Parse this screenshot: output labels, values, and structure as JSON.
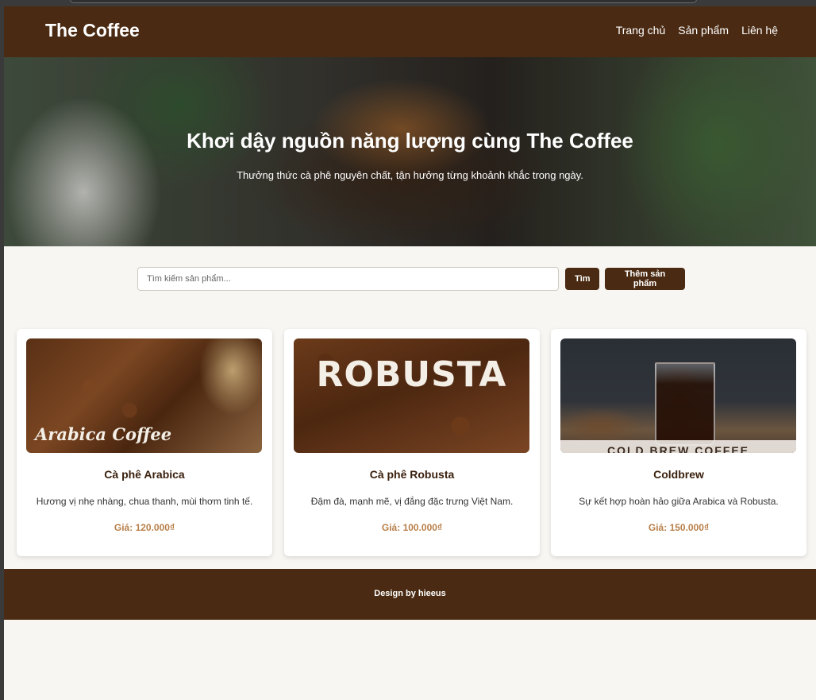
{
  "header": {
    "brand": "The Coffee",
    "nav": [
      "Trang chủ",
      "Sản phẩm",
      "Liên hệ"
    ]
  },
  "hero": {
    "title": "Khơi dậy nguồn năng lượng cùng The Coffee",
    "subtitle": "Thưởng thức cà phê nguyên chất, tận hưởng từng khoảnh khắc trong ngày."
  },
  "search": {
    "placeholder": "Tìm kiếm sản phẩm...",
    "search_label": "Tìm",
    "add_label": "Thêm sản phẩm"
  },
  "products": [
    {
      "image_text": "Arabica Coffee",
      "name": "Cà phê Arabica",
      "description": "Hương vị nhẹ nhàng, chua thanh, mùi thơm tinh tế.",
      "price": "Giá: 120.000₫"
    },
    {
      "image_text": "ROBUSTA",
      "name": "Cà phê Robusta",
      "description": "Đậm đà, mạnh mẽ, vị đắng đặc trưng Việt Nam.",
      "price": "Giá: 100.000₫"
    },
    {
      "image_text": "COLD BREW COFFEE",
      "name": "Coldbrew",
      "description": "Sự kết hợp hoàn hảo giữa Arabica và Robusta.",
      "price": "Giá: 150.000₫"
    }
  ],
  "footer": {
    "text": "Design by hieeus"
  },
  "colors": {
    "brand_brown": "#4a2a12",
    "price": "#b8804a",
    "background": "#f8f6f2"
  }
}
